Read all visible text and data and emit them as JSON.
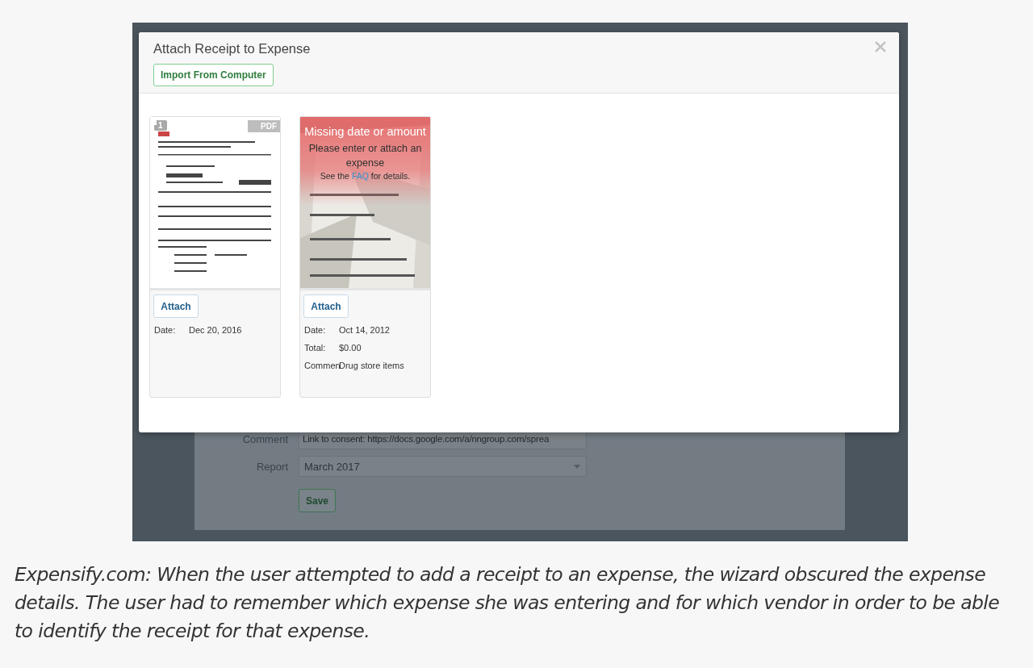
{
  "background_app": {
    "form": [
      {
        "kind": "text",
        "label": "Comment",
        "value": "Link to consent: https://docs.google.com/a/nngroup.com/sprea"
      },
      {
        "kind": "select",
        "label": "Report",
        "value": "March 2017"
      }
    ],
    "save_button": "Save"
  },
  "modal": {
    "title": "Attach Receipt to Expense",
    "import_button": "Import From Computer",
    "receipts": [
      {
        "kind": "pdf",
        "badge": "1",
        "file_tag": "PDF",
        "attach_button": "Attach",
        "fields": [
          {
            "label": "Date:",
            "value": "Dec 20, 2016"
          }
        ]
      },
      {
        "warning": {
          "title": "Missing date or amount",
          "message": "Please enter or attach an expense",
          "hint_before": "See the",
          "hint_link": "FAQ",
          "hint_after": "for details."
        },
        "attach_button": "Attach",
        "fields": [
          {
            "label": "Date:",
            "value": "Oct 14, 2012"
          },
          {
            "label": "Total:",
            "value": "$0.00"
          },
          {
            "label": "Commen",
            "value": "Drug store items"
          }
        ]
      }
    ]
  },
  "caption": "Expensify.com: When the user attempted to add a receipt to an expense, the wizard obscured the expense details. The user had to remember which expense she was entering and for which vendor in order to be able to identify the receipt for that expense."
}
